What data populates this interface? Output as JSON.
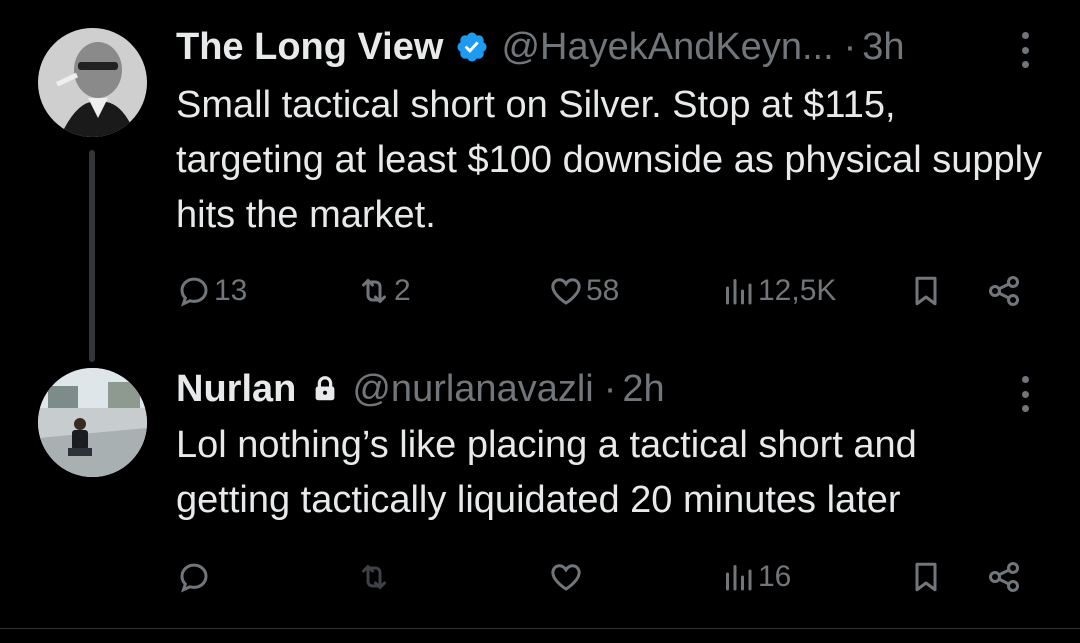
{
  "tweets": [
    {
      "author_name": "The Long View",
      "verified": true,
      "handle": "@HayekAndKeyn...",
      "separator": "·",
      "time": "3h",
      "text": "Small tactical short on Silver. Stop at $115, targeting at least $100 downside as physical supply hits the market.",
      "replies": "13",
      "reposts": "2",
      "likes": "58",
      "views": "12,5K"
    },
    {
      "author_name": "Nurlan",
      "protected": true,
      "handle": "@nurlanavazli",
      "separator": "·",
      "time": "2h",
      "text_line1": "Lol nothing’s like placing a tactical short and",
      "text_line2": "getting tactically liquidated 20 minutes later",
      "replies": "",
      "reposts": "",
      "likes": "",
      "views": "16"
    }
  ],
  "colors": {
    "background": "#000000",
    "text": "#e7e9ea",
    "muted": "#71767b",
    "verified": "#1d9bf0"
  },
  "icons": [
    "reply-icon",
    "repost-icon",
    "like-icon",
    "views-icon",
    "bookmark-icon",
    "share-icon",
    "more-icon",
    "verified-icon",
    "lock-icon"
  ]
}
